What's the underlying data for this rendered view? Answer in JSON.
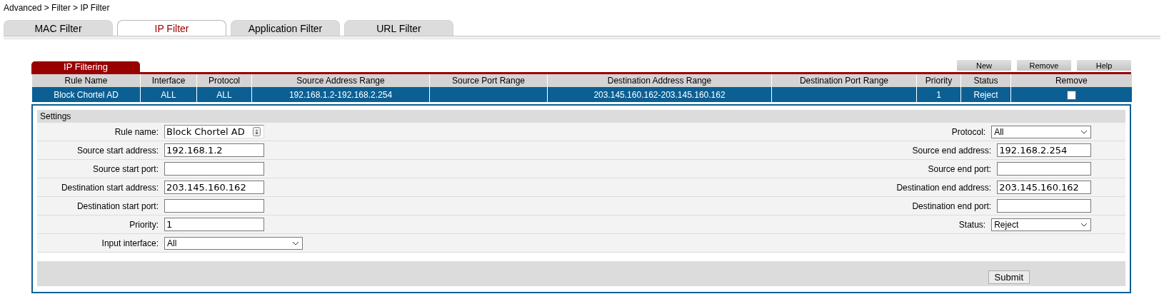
{
  "breadcrumb": "Advanced > Filter > IP Filter",
  "tabs": [
    {
      "label": "MAC Filter",
      "selected": false
    },
    {
      "label": "IP Filter",
      "selected": true
    },
    {
      "label": "Application Filter",
      "selected": false
    },
    {
      "label": "URL Filter",
      "selected": false
    }
  ],
  "rule_list": {
    "title": "IP Filtering",
    "buttons": [
      "New",
      "Remove",
      "Help"
    ],
    "columns": [
      "Rule Name",
      "Interface",
      "Protocol",
      "Source Address Range",
      "Source Port Range",
      "Destination Address Range",
      "Destination Port Range",
      "Priority",
      "Status",
      "Remove"
    ],
    "rows": [
      {
        "selected": true,
        "cells": [
          "Block Chortel AD",
          "ALL",
          "ALL",
          "192.168.1.2-192.168.2.254",
          "",
          "203.145.160.162-203.145.160.162",
          "",
          "1",
          "Reject"
        ],
        "remove_checked": false
      }
    ]
  },
  "settings": {
    "title": "Settings",
    "rows": [
      {
        "left": {
          "label": "Rule name:",
          "kind": "autofill",
          "value": "Block Chortel AD"
        },
        "right": {
          "label": "Protocol:",
          "kind": "select",
          "value": "All"
        }
      },
      {
        "left": {
          "label": "Source start address:",
          "kind": "text",
          "value": "192.168.1.2"
        },
        "right": {
          "label": "Source end address:",
          "kind": "text",
          "value": "192.168.2.254"
        }
      },
      {
        "left": {
          "label": "Source start port:",
          "kind": "text"
        },
        "right": {
          "label": "Source end port:",
          "kind": "text"
        }
      },
      {
        "left": {
          "label": "Destination start address:",
          "kind": "text",
          "value": "203.145.160.162"
        },
        "right": {
          "label": "Destination end address:",
          "kind": "text",
          "value": "203.145.160.162"
        }
      },
      {
        "left": {
          "label": "Destination start port:",
          "kind": "text"
        },
        "right": {
          "label": "Destination end port:",
          "kind": "text"
        }
      },
      {
        "left": {
          "label": "Priority:",
          "kind": "text",
          "value": "1"
        },
        "right": {
          "label": "Status:",
          "kind": "select",
          "value": "Reject"
        }
      },
      {
        "left": {
          "label": "Input interface:",
          "kind": "wideselect",
          "value": "All"
        }
      }
    ],
    "submit": "Submit"
  }
}
